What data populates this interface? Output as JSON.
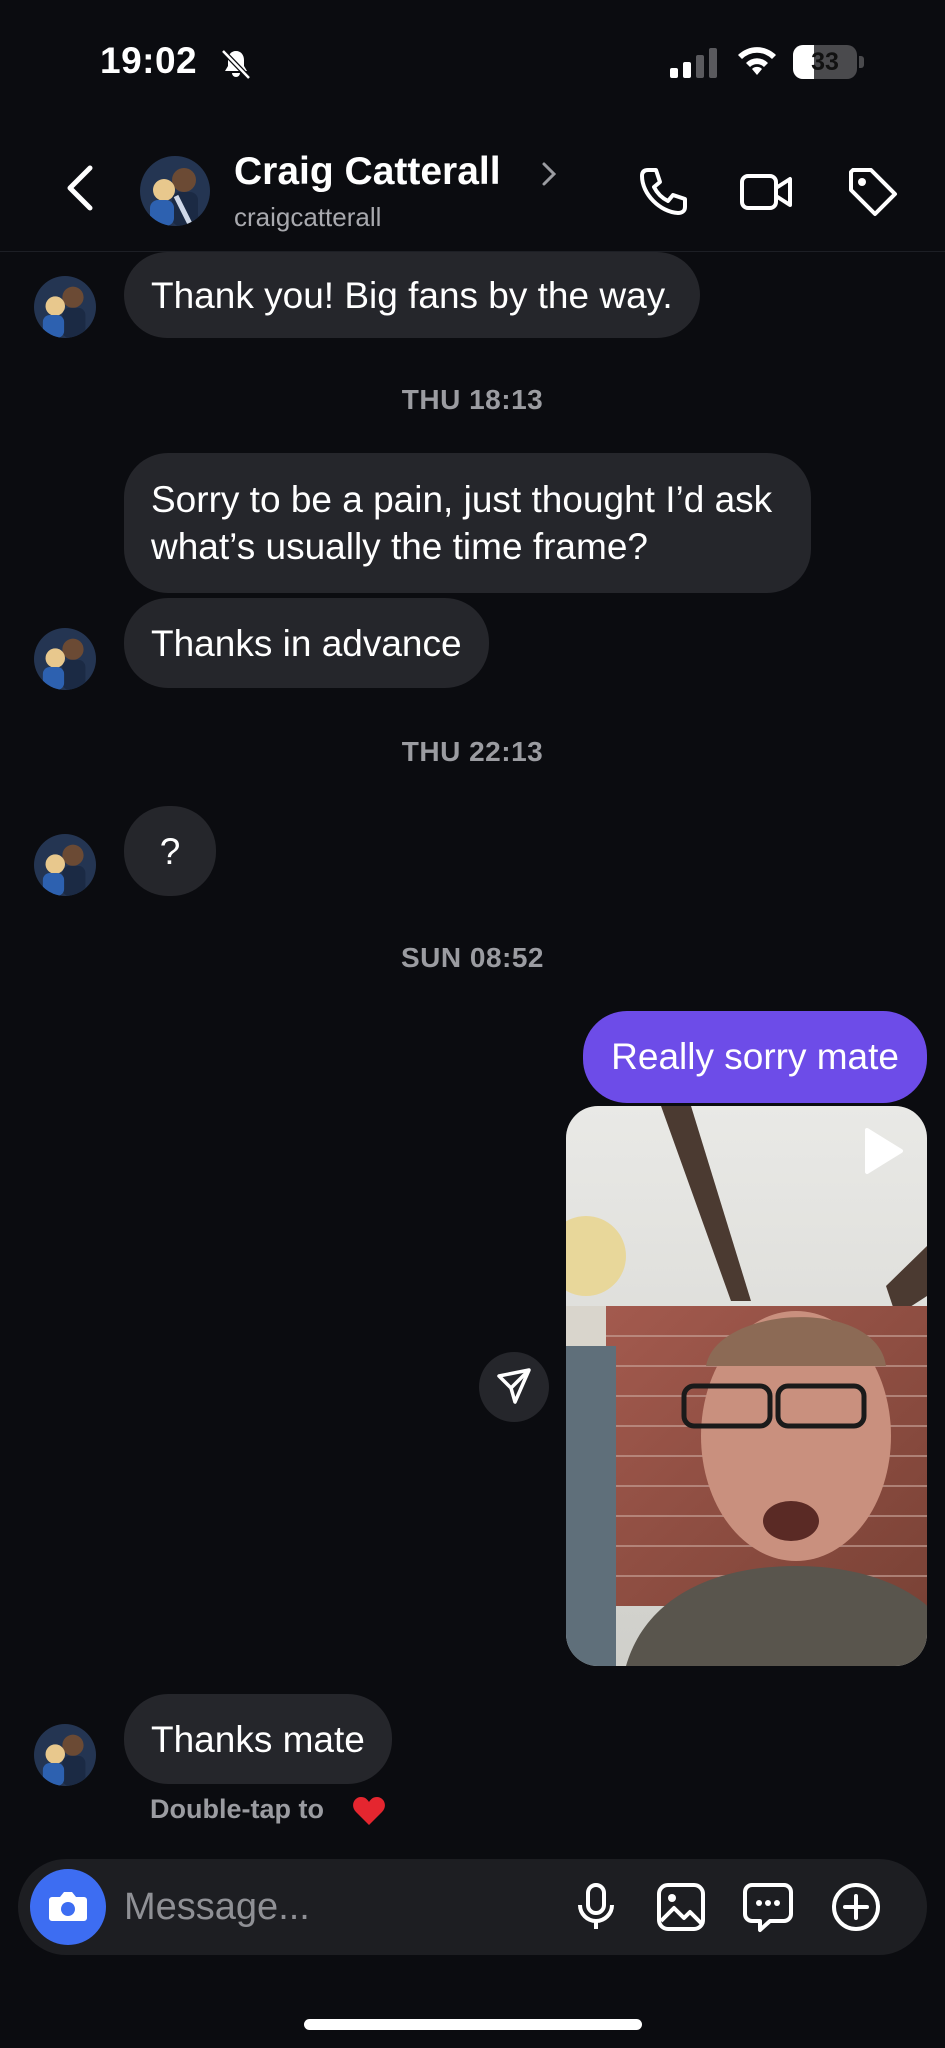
{
  "status_bar": {
    "time": "19:02",
    "battery": "33",
    "battery_level_percent": 33,
    "icons": [
      "bell-slash-icon",
      "cellular-signal-icon",
      "wifi-icon",
      "battery-icon"
    ]
  },
  "header": {
    "contact_name": "Craig Catterall",
    "username": "craigcatterall",
    "icons": [
      "back-chevron-icon",
      "chevron-right-icon",
      "phone-icon",
      "video-camera-icon",
      "tag-icon"
    ]
  },
  "messages": {
    "m1": "Thank you! Big fans by the way.",
    "ts1": "THU 18:13",
    "m2": "Sorry to be a pain, just thought I’d ask what’s usually the time frame?",
    "m3": "Thanks in advance",
    "ts2": "THU 22:13",
    "m4": "?",
    "ts3": "SUN 08:52",
    "m5": "Really sorry mate",
    "m6": "Thanks mate",
    "double_tap": "Double-tap to"
  },
  "composer": {
    "placeholder": "Message...",
    "icons": [
      "camera-icon",
      "microphone-icon",
      "image-icon",
      "sticker-icon",
      "plus-circle-icon"
    ]
  },
  "colors": {
    "background": "#0b0c10",
    "incoming_bubble": "#25262b",
    "outgoing_bubble": "#6d4ce8",
    "camera_button": "#3d6df2",
    "heart": "#e5262f"
  }
}
